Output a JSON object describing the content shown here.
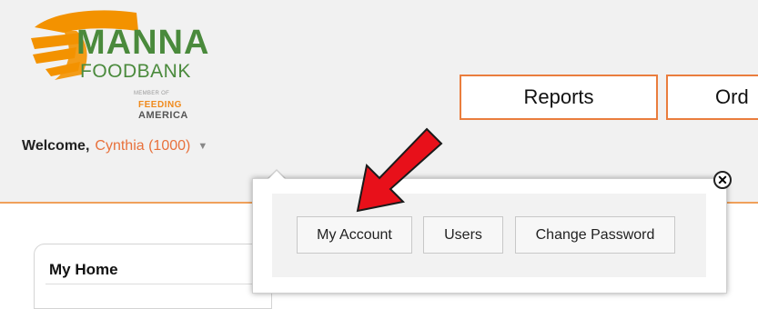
{
  "logo": {
    "name": "MANNA",
    "sub": "FOODBANK",
    "member_of": "MEMBER OF",
    "feeding": "FEEDING",
    "america": "AMERICA"
  },
  "welcome": {
    "label": "Welcome,",
    "user": "Cynthia (1000)",
    "caret_icon": "▼"
  },
  "nav": {
    "reports": "Reports",
    "orders_partial": "Ord"
  },
  "popup": {
    "close_icon": "✕",
    "buttons": [
      "My Account",
      "Users",
      "Change Password"
    ]
  },
  "home": {
    "title": "My Home"
  },
  "colors": {
    "accent": "#ea7d3d",
    "brand_green": "#4a8a3c",
    "annotation_arrow": "#e8101a"
  }
}
